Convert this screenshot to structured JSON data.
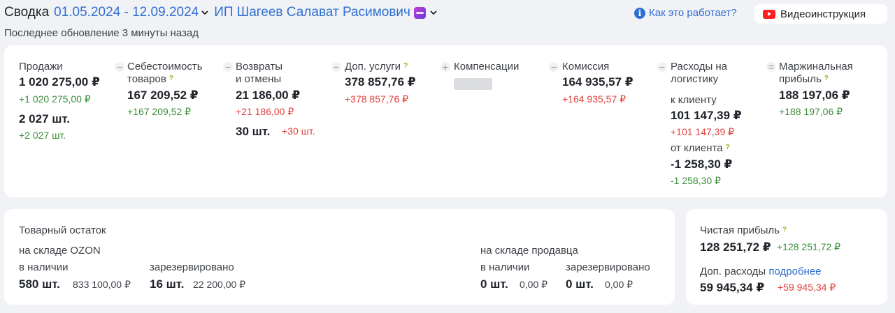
{
  "header": {
    "title": "Сводка",
    "dates": "01.05.2024 - 12.09.2024",
    "company": "ИП Шагеев Салават Расимович",
    "updated": "Последнее обновление 3 минуты назад",
    "help_link": "Как это работает?",
    "video_button": "Видеоинструкция"
  },
  "metrics": {
    "sales": {
      "label": "Продажи",
      "amount": "1 020 275,00 ₽",
      "amount_delta": "+1 020 275,00 ₽",
      "count": "2 027 шт.",
      "count_delta": "+2 027 шт."
    },
    "cost": {
      "op": "−",
      "label_line1": "Себестоимость",
      "label_line2": "товаров",
      "amount": "167 209,52 ₽",
      "amount_delta": "+167 209,52 ₽"
    },
    "returns": {
      "op": "−",
      "label_line1": "Возвраты",
      "label_line2": "и отмены",
      "amount": "21 186,00 ₽",
      "amount_delta": "+21 186,00 ₽",
      "count": "30 шт.",
      "count_delta": "+30 шт."
    },
    "extra_services": {
      "op": "−",
      "label": "Доп. услуги",
      "amount": "378 857,76 ₽",
      "amount_delta": "+378 857,76 ₽"
    },
    "compensation": {
      "op": "+",
      "label": "Компенсации"
    },
    "commission": {
      "op": "−",
      "label": "Комиссия",
      "amount": "164 935,57 ₽",
      "amount_delta": "+164 935,57 ₽"
    },
    "logistics": {
      "op": "−",
      "label_line1": "Расходы на",
      "label_line2": "логистику",
      "to_client_label": "к клиенту",
      "to_client_amount": "101 147,39 ₽",
      "to_client_delta": "+101 147,39 ₽",
      "from_client_label": "от клиента",
      "from_client_amount": "-1 258,30 ₽",
      "from_client_delta": "-1 258,30 ₽"
    },
    "margin": {
      "op": "=",
      "label_line1": "Маржинальная",
      "label_line2": "прибыль",
      "amount": "188 197,06 ₽",
      "amount_delta": "+188 197,06 ₽"
    },
    "question_mark": "?"
  },
  "stock": {
    "title": "Товарный остаток",
    "ozon": {
      "label": "на складе OZON",
      "available_label": "в наличии",
      "available_count": "580 шт.",
      "available_amount": "833 100,00 ₽",
      "reserved_label": "зарезервировано",
      "reserved_count": "16 шт.",
      "reserved_amount": "22 200,00 ₽"
    },
    "seller": {
      "label": "на складе продавца",
      "available_label": "в наличии",
      "available_count": "0 шт.",
      "available_amount": "0,00 ₽",
      "reserved_label": "зарезервировано",
      "reserved_count": "0 шт.",
      "reserved_amount": "0,00 ₽"
    }
  },
  "profit": {
    "net_label": "Чистая прибыль",
    "net_amount": "128 251,72 ₽",
    "net_delta": "+128 251,72 ₽",
    "extra_label": "Доп. расходы",
    "extra_link": "подробнее",
    "extra_amount": "59 945,34 ₽",
    "extra_delta": "+59 945,34 ₽"
  },
  "colors": {
    "accent_blue": "#2f6fd1",
    "positive_green": "#3a8f3a",
    "negative_red": "#e0413c",
    "background": "#f1f2f6"
  }
}
